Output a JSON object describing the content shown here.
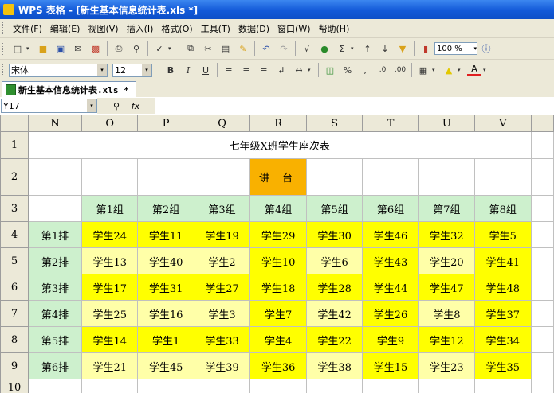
{
  "window": {
    "title": "WPS 表格 - [新生基本信息统计表.xls *]"
  },
  "menu": [
    "文件(F)",
    "编辑(E)",
    "视图(V)",
    "插入(I)",
    "格式(O)",
    "工具(T)",
    "数据(D)",
    "窗口(W)",
    "帮助(H)"
  ],
  "toolbar": {
    "zoom": "100 %",
    "font_name": "宋体",
    "font_size": "12",
    "bold": "B",
    "italic": "I",
    "underline": "U",
    "percent": "%"
  },
  "tab": {
    "label": "新生基本信息统计表.xls *"
  },
  "formula_bar": {
    "cell_ref": "Y17",
    "fx": "fx",
    "value": ""
  },
  "sheet": {
    "columns": [
      "N",
      "O",
      "P",
      "Q",
      "R",
      "S",
      "T",
      "U",
      "V"
    ],
    "row_numbers": [
      "1",
      "2",
      "3",
      "4",
      "5",
      "6",
      "7",
      "8",
      "9",
      "10"
    ],
    "title": "七年级X班学生座次表",
    "podium": "讲 台",
    "groups": [
      "第1组",
      "第2组",
      "第3组",
      "第4组",
      "第5组",
      "第6组",
      "第7组",
      "第8组"
    ],
    "row_labels": [
      "第1排",
      "第2排",
      "第3排",
      "第4排",
      "第5排",
      "第6排"
    ],
    "seats": [
      [
        "学生24",
        "学生11",
        "学生19",
        "学生29",
        "学生30",
        "学生46",
        "学生32",
        "学生5"
      ],
      [
        "学生13",
        "学生40",
        "学生2",
        "学生10",
        "学生6",
        "学生43",
        "学生20",
        "学生41"
      ],
      [
        "学生17",
        "学生31",
        "学生27",
        "学生18",
        "学生28",
        "学生44",
        "学生47",
        "学生48"
      ],
      [
        "学生25",
        "学生16",
        "学生3",
        "学生7",
        "学生42",
        "学生26",
        "学生8",
        "学生37"
      ],
      [
        "学生14",
        "学生1",
        "学生33",
        "学生4",
        "学生22",
        "学生9",
        "学生12",
        "学生34"
      ],
      [
        "学生21",
        "学生45",
        "学生39",
        "学生36",
        "学生38",
        "学生15",
        "学生23",
        "学生35"
      ]
    ]
  },
  "colors": {
    "podium": "#f9b100",
    "header_green": "#cdf0cd",
    "seat_yellow": "#ffff00",
    "label_red": "#e02020"
  }
}
